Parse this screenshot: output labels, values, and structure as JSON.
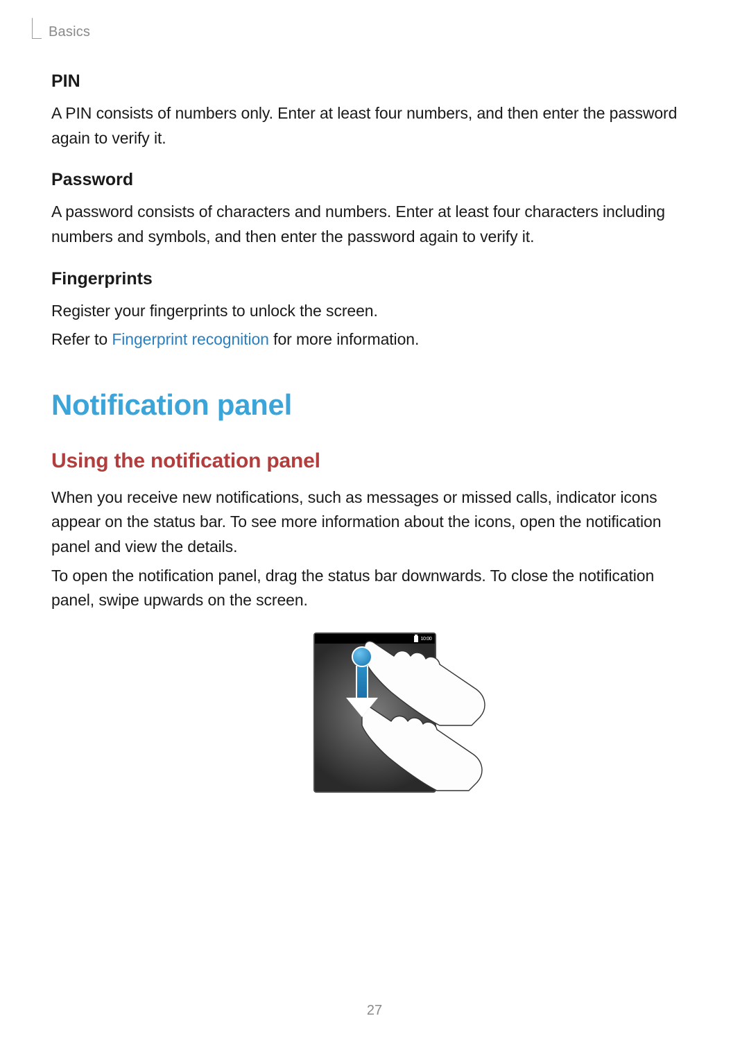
{
  "breadcrumb": "Basics",
  "sections": {
    "pin": {
      "heading": "PIN",
      "body": "A PIN consists of numbers only. Enter at least four numbers, and then enter the password again to verify it."
    },
    "password": {
      "heading": "Password",
      "body": "A password consists of characters and numbers. Enter at least four characters including numbers and symbols, and then enter the password again to verify it."
    },
    "fingerprints": {
      "heading": "Fingerprints",
      "line1": "Register your fingerprints to unlock the screen.",
      "refer_prefix": "Refer to ",
      "refer_link": "Fingerprint recognition",
      "refer_suffix": " for more information."
    }
  },
  "notification": {
    "title": "Notification panel",
    "subheading": "Using the notification panel",
    "para1": "When you receive new notifications, such as messages or missed calls, indicator icons appear on the status bar. To see more information about the icons, open the notification panel and view the details.",
    "para2": "To open the notification panel, drag the status bar downwards. To close the notification panel, swipe upwards on the screen."
  },
  "figure": {
    "status_time": "10:00"
  },
  "page_number": "27"
}
